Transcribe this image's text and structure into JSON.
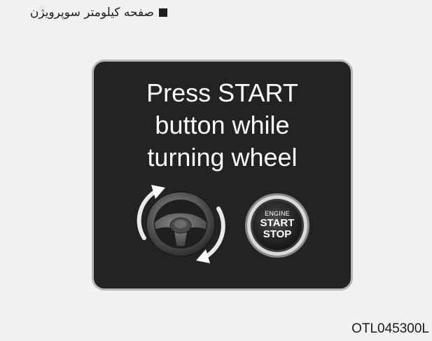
{
  "header": {
    "title": "صفحه کیلومتر سوپرویژن"
  },
  "display": {
    "message_lines": [
      "Press START",
      "button while",
      "turning wheel"
    ],
    "engine_button": {
      "top_label": "ENGINE",
      "line1": "START",
      "line2": "STOP"
    },
    "icons": [
      "steering-wheel-icon",
      "rotate-arrows-icon",
      "engine-start-stop-button-icon"
    ]
  },
  "footer": {
    "reference_code": "OTL045300L"
  },
  "colors": {
    "page_background": "#f1f1f1",
    "display_background": "#232323",
    "display_border": "#b8b8b8",
    "text_dark": "#1d1d1d",
    "text_light": "#ffffff"
  }
}
